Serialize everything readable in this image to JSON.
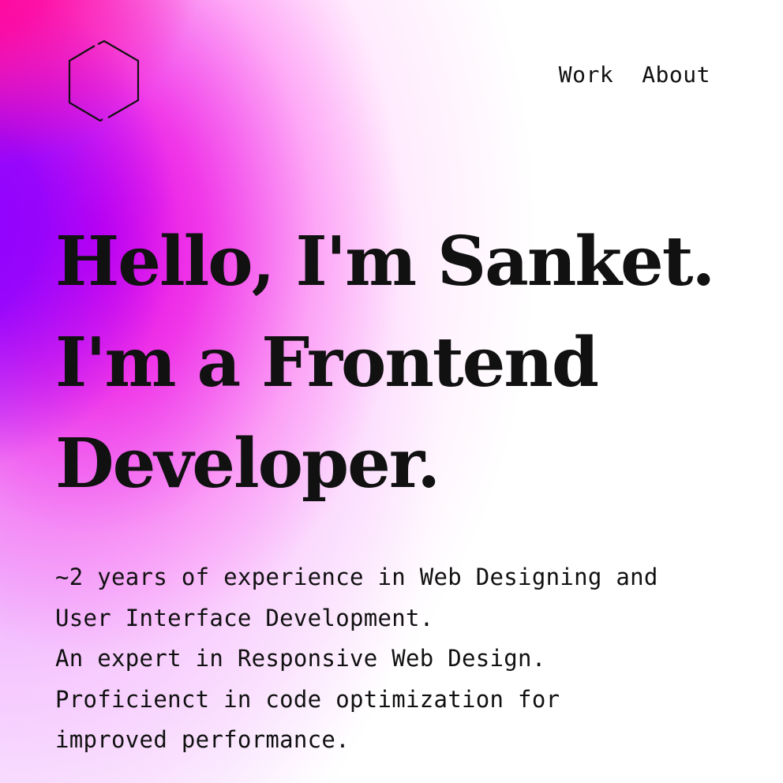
{
  "logo": {
    "icon": "hexagon-logo-icon",
    "stroke_color": "#111111"
  },
  "nav": {
    "items": [
      {
        "label": "Work"
      },
      {
        "label": "About"
      }
    ]
  },
  "hero": {
    "lines": [
      "Hello, I'm Sanket.",
      "I'm a Frontend",
      "Developer."
    ]
  },
  "description": {
    "lines": [
      "~2 years of experience in Web Designing and",
      "User Interface Development.",
      "An expert in Responsive Web Design.",
      "Proficienct in code optimization for",
      "improved performance."
    ]
  },
  "colors": {
    "gradient_pink": "#ff0099",
    "gradient_purple": "#8a00ff",
    "gradient_magenta": "#e000e8",
    "background": "#ffffff",
    "text": "#111111"
  }
}
